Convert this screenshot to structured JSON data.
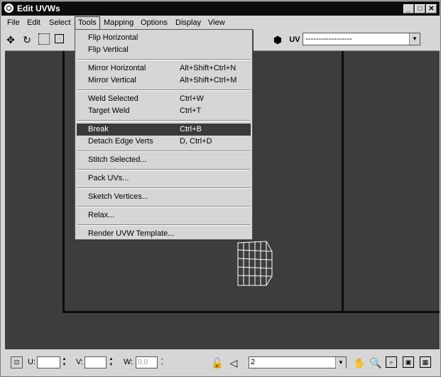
{
  "window": {
    "title": "Edit UVWs"
  },
  "menubar": [
    "File",
    "Edit",
    "Select",
    "Tools",
    "Mapping",
    "Options",
    "Display",
    "View"
  ],
  "toolbar": {
    "uv_label": "UV",
    "map_combo_value": "------------------"
  },
  "tools_menu": [
    {
      "label": "Flip Horizontal",
      "shortcut": ""
    },
    {
      "label": "Flip Vertical",
      "shortcut": ""
    },
    {
      "label": "Mirror Horizontal",
      "shortcut": "Alt+Shift+Ctrl+N"
    },
    {
      "label": "Mirror Vertical",
      "shortcut": "Alt+Shift+Ctrl+M"
    },
    {
      "label": "Weld Selected",
      "shortcut": "Ctrl+W"
    },
    {
      "label": "Target Weld",
      "shortcut": "Ctrl+T"
    },
    {
      "label": "Break",
      "shortcut": "Ctrl+B",
      "highlighted": true
    },
    {
      "label": "Detach Edge Verts",
      "shortcut": "D, Ctrl+D"
    },
    {
      "label": "Stitch Selected...",
      "shortcut": ""
    },
    {
      "label": "Pack UVs...",
      "shortcut": ""
    },
    {
      "label": "Sketch Vertices...",
      "shortcut": ""
    },
    {
      "label": "Relax...",
      "shortcut": ""
    },
    {
      "label": "Render UVW Template...",
      "shortcut": ""
    }
  ],
  "status": {
    "u_label": "U:",
    "v_label": "V:",
    "w_label": "W:",
    "u_value": "",
    "v_value": "",
    "w_value": "0.0",
    "element_combo_value": "2"
  },
  "colors": {
    "viewport_bg": "#3d3d3d",
    "highlight": "#3a3a3a",
    "chrome": "#d6d6d6"
  }
}
